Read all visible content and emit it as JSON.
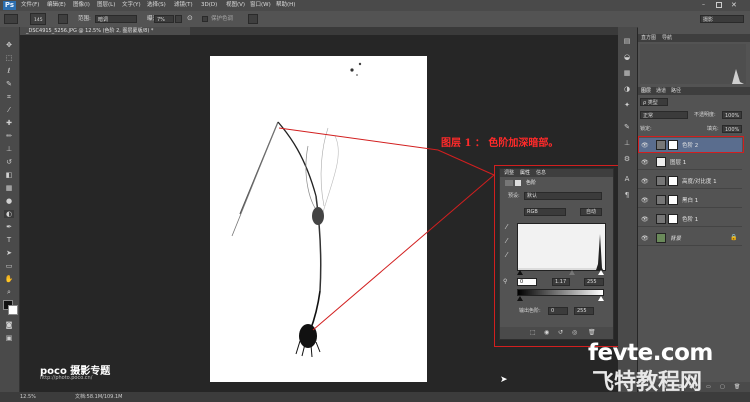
{
  "app": {
    "logo": "Ps"
  },
  "menubar": {
    "items": [
      "文件(F)",
      "编辑(E)",
      "图像(I)",
      "图层(L)",
      "文字(Y)",
      "选择(S)",
      "滤镜(T)",
      "3D(D)",
      "视图(V)",
      "窗口(W)",
      "帮助(H)"
    ],
    "workspace": "摄影"
  },
  "options": {
    "brush_size": "145",
    "range_label": "范围:",
    "range_value": "暗调",
    "exposure_label": "曝光度:",
    "exposure_value": "7%",
    "protect_tones": "保护色调"
  },
  "document": {
    "tab_title": "_DSC4915_5256.JPG @ 12.5% (色阶 2, 图层蒙版/8) *"
  },
  "status": {
    "zoom": "12.5%",
    "doc_info": "文档:58.1M/109.1M"
  },
  "panels": {
    "top_tabs": [
      "直方图",
      "导航"
    ],
    "layers_tabs": [
      "图层",
      "通道",
      "路径"
    ],
    "kind_label": "ρ 类型",
    "blend_mode": "正常",
    "opacity_label": "不透明度:",
    "opacity_value": "100%",
    "lock_label": "锁定:",
    "fill_label": "填充:",
    "fill_value": "100%",
    "layers": [
      {
        "name": "色阶 2",
        "selected": true,
        "type": "adjust",
        "has_mask": true
      },
      {
        "name": "图层 1",
        "selected": false,
        "type": "pixel",
        "has_mask": false
      },
      {
        "name": "高度/对比度 1",
        "selected": false,
        "type": "adjust",
        "has_mask": true
      },
      {
        "name": "黑白 1",
        "selected": false,
        "type": "adjust",
        "has_mask": true
      },
      {
        "name": "色阶 1",
        "selected": false,
        "type": "adjust",
        "has_mask": true
      },
      {
        "name": "背景",
        "selected": false,
        "type": "background",
        "has_mask": false
      }
    ]
  },
  "properties": {
    "tabs": [
      "调整",
      "属性",
      "信息"
    ],
    "title": "色阶",
    "preset_label": "预设:",
    "preset_value": "默认",
    "channel_value": "RGB",
    "auto_button": "自动",
    "input_black": "0",
    "input_gamma": "1.17",
    "input_white": "255",
    "output_label": "输出色阶:",
    "output_black": "0",
    "output_white": "255"
  },
  "callout": {
    "text": "图层 1 ：  色阶加深暗部。"
  },
  "watermarks": {
    "poco": "poco 摄影专题",
    "poco_url": "http://photo.poco.cn/",
    "fevte": "fevte.com",
    "fevte_cn": "飞特教程网"
  },
  "colors": {
    "annotation_red": "#d21f1f",
    "selected_layer": "#5a6d8e",
    "ps_blue": "#2c6fb0"
  }
}
